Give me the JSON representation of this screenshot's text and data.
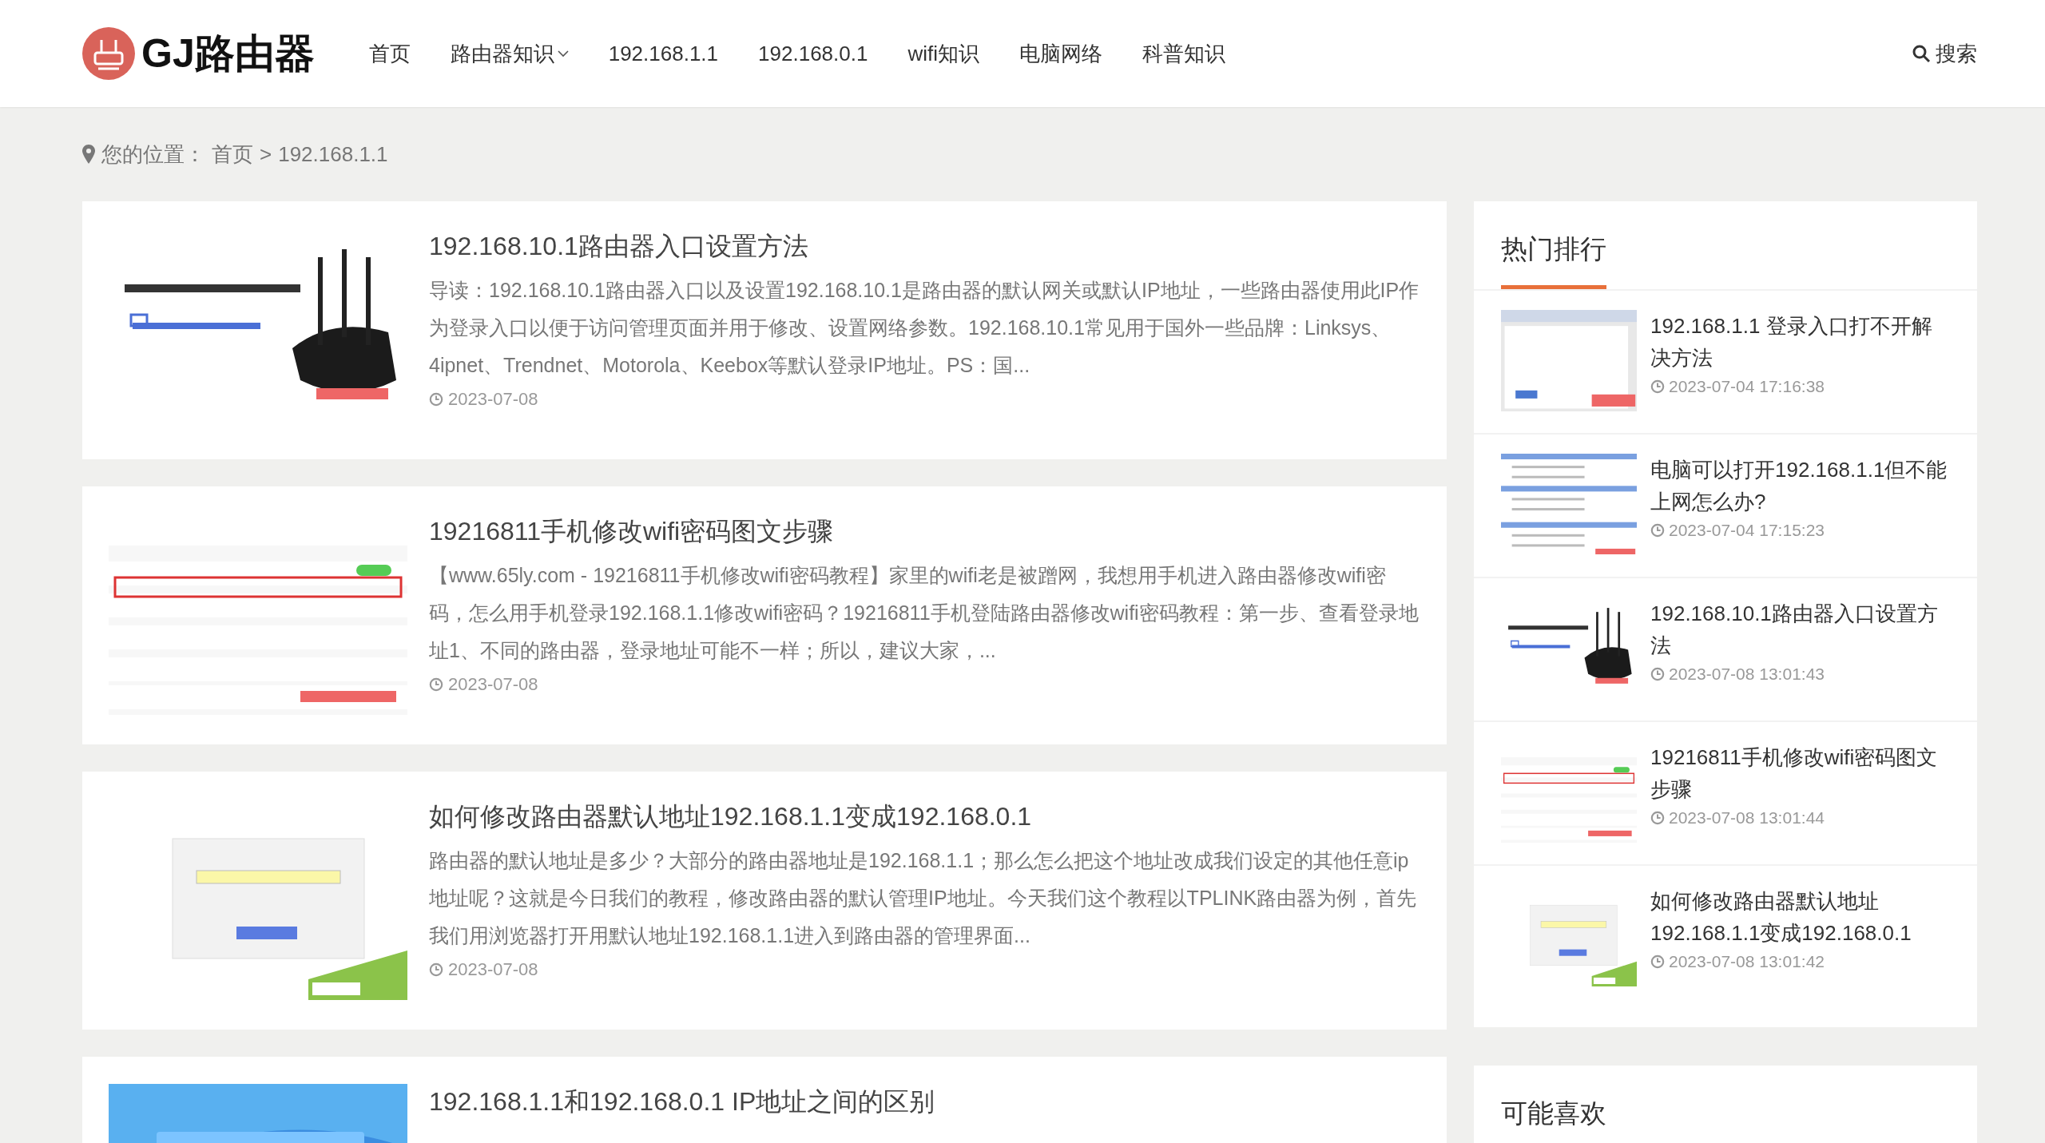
{
  "site": {
    "logo_text": "GJ路由器"
  },
  "nav": [
    {
      "label": "首页",
      "dropdown": false
    },
    {
      "label": "路由器知识",
      "dropdown": true
    },
    {
      "label": "192.168.1.1",
      "dropdown": false
    },
    {
      "label": "192.168.0.1",
      "dropdown": false
    },
    {
      "label": "wifi知识",
      "dropdown": false
    },
    {
      "label": "电脑网络",
      "dropdown": false
    },
    {
      "label": "科普知识",
      "dropdown": false
    }
  ],
  "search": {
    "label": "搜索"
  },
  "breadcrumb": {
    "prefix": "您的位置：",
    "items": [
      "首页",
      "192.168.1.1"
    ],
    "separator": ">"
  },
  "articles": [
    {
      "title": "192.168.10.1路由器入口设置方法",
      "excerpt": "导读：192.168.10.1路由器入口以及设置192.168.10.1是路由器的默认网关或默认IP地址，一些路由器使用此IP作为登录入口以便于访问管理页面并用于修改、设置网络参数。192.168.10.1常见用于国外一些品牌：Linksys、4ipnet、Trendnet、Motorola、Keebox等默认登录IP地址。PS：国...",
      "date": "2023-07-08"
    },
    {
      "title": "19216811手机修改wifi密码图文步骤",
      "excerpt": "【www.65ly.com - 19216811手机修改wifi密码教程】家里的wifi老是被蹭网，我想用手机进入路由器修改wifi密码，怎么用手机登录192.168.1.1修改wifi密码？19216811手机登陆路由器修改wifi密码教程：第一步、查看登录地址1、不同的路由器，登录地址可能不一样；所以，建议大家，...",
      "date": "2023-07-08"
    },
    {
      "title": "如何修改路由器默认地址192.168.1.1变成192.168.0.1",
      "excerpt": "路由器的默认地址是多少？大部分的路由器地址是192.168.1.1；那么怎么把这个地址改成我们设定的其他任意ip地址呢？这就是今日我们的教程，修改路由器的默认管理IP地址。今天我们这个教程以TPLINK路由器为例，首先我们用浏览器打开用默认地址192.168.1.1进入到路由器的管理界面...",
      "date": "2023-07-08"
    },
    {
      "title": "192.168.1.1和192.168.0.1 IP地址之间的区别"
    }
  ],
  "sidebar": [
    {
      "title": "热门排行",
      "items": [
        {
          "title": "192.168.1.1 登录入口打不开解决方法",
          "date": "2023-07-04 17:16:38"
        },
        {
          "title": "电脑可以打开192.168.1.1但不能上网怎么办?",
          "date": "2023-07-04 17:15:23"
        },
        {
          "title": "192.168.10.1路由器入口设置方法",
          "date": "2023-07-08 13:01:43"
        },
        {
          "title": "19216811手机修改wifi密码图文步骤",
          "date": "2023-07-08 13:01:44"
        },
        {
          "title": "如何修改路由器默认地址192.168.1.1变成192.168.0.1",
          "date": "2023-07-08 13:01:42"
        }
      ]
    },
    {
      "title": "可能喜欢"
    }
  ]
}
